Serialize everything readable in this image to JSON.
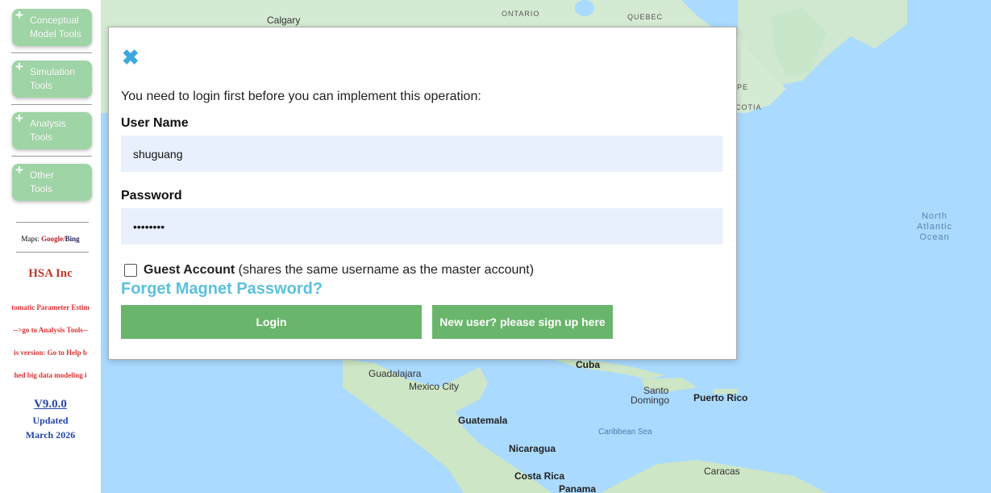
{
  "sidebar": {
    "tools": [
      {
        "line1": "Conceptual",
        "line2": "Model Tools"
      },
      {
        "line1": "Simulation",
        "line2": "Tools"
      },
      {
        "line1": "Analysis",
        "line2": "Tools"
      },
      {
        "line1": "Other",
        "line2": "Tools"
      }
    ],
    "maps_prefix": "Maps: ",
    "maps_google": "Google",
    "maps_sep": "/",
    "maps_bing": "Bing",
    "company": "HSA Inc",
    "news": [
      "tomatic Parameter Estim",
      "-->go to Analysis Tools--",
      "is version: Go to Help b",
      "hed big data modeling i"
    ],
    "version": "V9.0.0",
    "updated": "Updated",
    "updated_date": "March 2026"
  },
  "map": {
    "labels": {
      "calgary": "Calgary",
      "ontario": "ONTARIO",
      "quebec": "QUEBEC",
      "pe": "PE",
      "scotia": "COTIA",
      "north_atlantic_1": "North",
      "north_atlantic_2": "Atlantic",
      "north_atlantic_3": "Ocean",
      "cuba": "Cuba",
      "guadalajara": "Guadalajara",
      "mexico_city": "Mexico City",
      "santo": "Santo",
      "domingo": "Domingo",
      "puerto_rico": "Puerto Rico",
      "guatemala": "Guatemala",
      "caribbean": "Caribbean Sea",
      "nicaragua": "Nicaragua",
      "caracas": "Caracas",
      "costa_rica": "Costa Rica",
      "panama": "Panama"
    }
  },
  "modal": {
    "close_glyph": "✖",
    "prompt": "You need to login first before you can implement this operation:",
    "username_label": "User Name",
    "username_value": "shuguang",
    "password_label": "Password",
    "password_value": "••••••••",
    "guest_bold": "Guest Account",
    "guest_rest": " (shares the same username as the master account)",
    "forget_link": "Forget Magnet Password?",
    "login_button": "Login",
    "signup_button": "New user? please sign up here"
  },
  "colors": {
    "tool_button": "#9fd4a6",
    "action_button": "#6ab56c",
    "link": "#5bc0de",
    "close": "#3ea9e0",
    "input_bg": "#e8f0fe",
    "company": "#c0392b",
    "version": "#2346a8"
  }
}
